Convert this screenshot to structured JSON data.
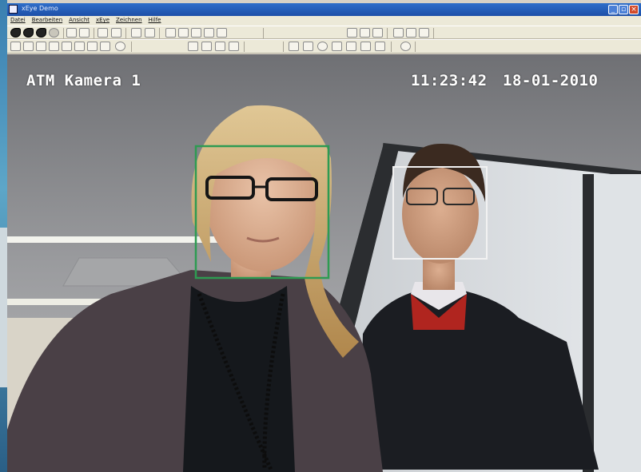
{
  "window": {
    "title": "xEye Demo"
  },
  "menu": {
    "items": [
      "Datei",
      "Bearbeiten",
      "Ansicht",
      "xEye",
      "Zeichnen",
      "Hilfe"
    ]
  },
  "camera": {
    "label": "ATM Kamera 1",
    "time": "11:23:42",
    "date": "18-01-2010",
    "detections": [
      {
        "name": "face-box-woman",
        "color": "#2e9b52"
      },
      {
        "name": "face-box-man",
        "color": "#f2f2f2"
      }
    ]
  }
}
